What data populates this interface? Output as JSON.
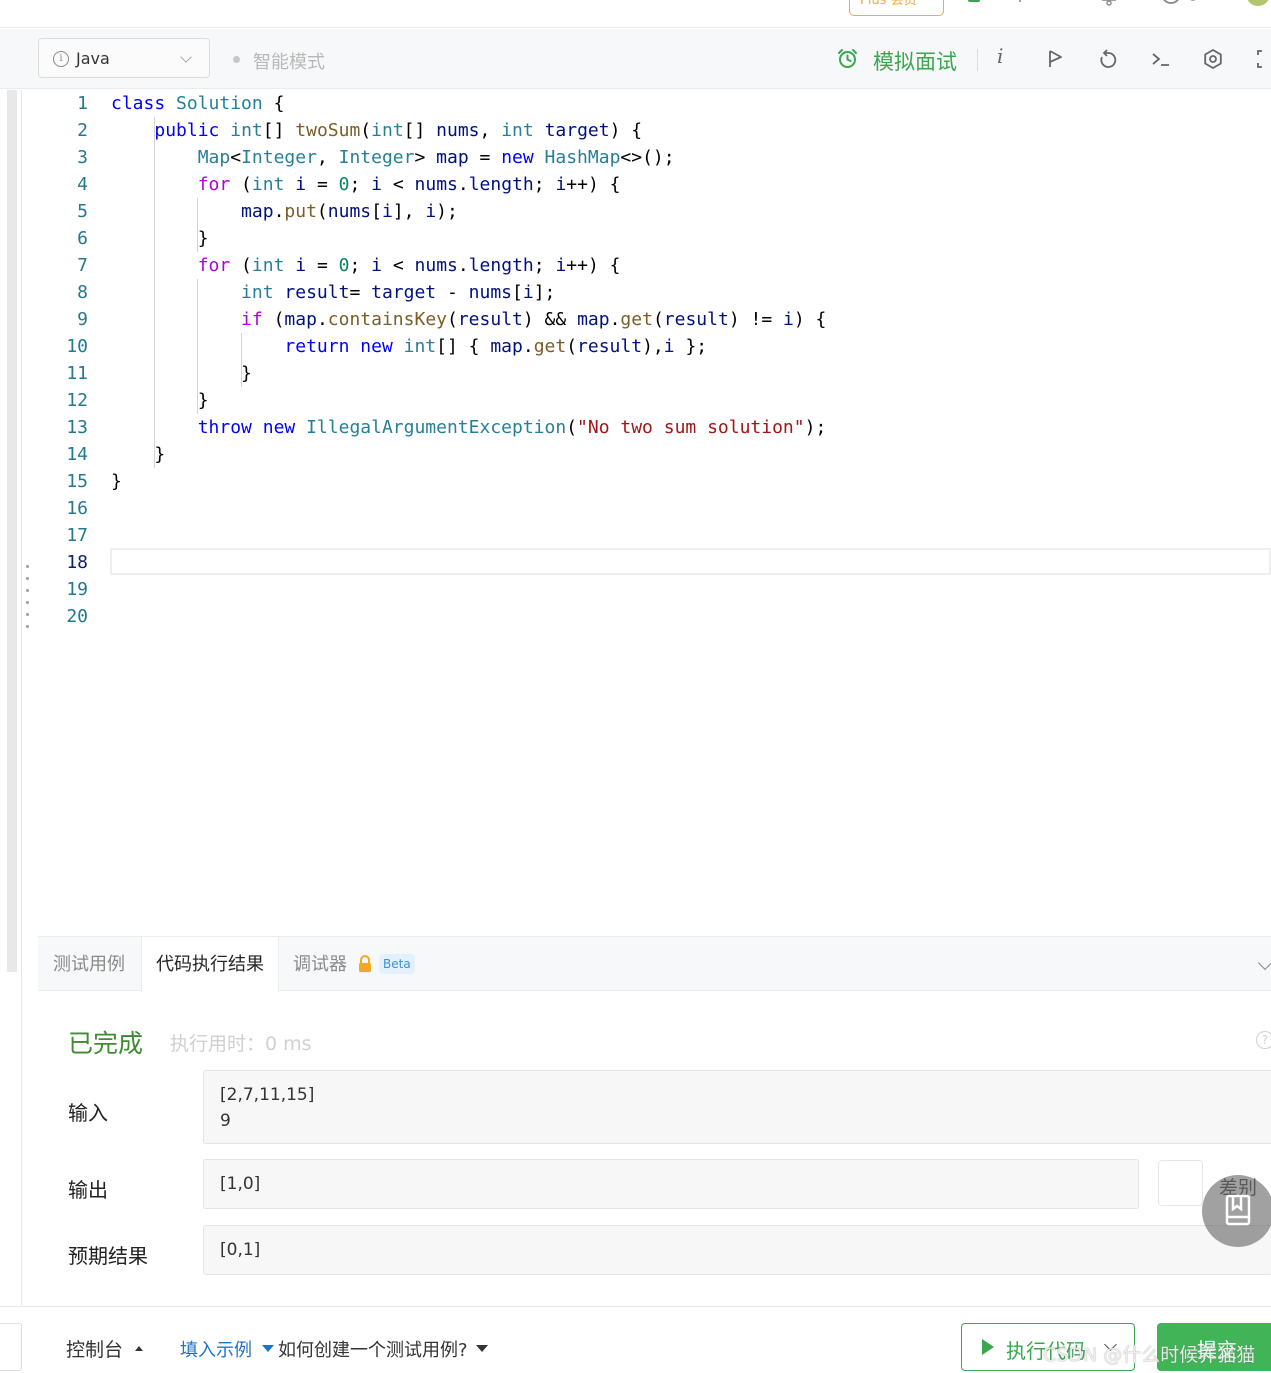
{
  "top_strip": {
    "plus_badge": "Plus 会员"
  },
  "toolbar": {
    "language": "Java",
    "smart_mode": "智能模式",
    "mock_interview": "模拟面试",
    "info_icon_text": "i"
  },
  "editor": {
    "active_line": "18",
    "lines": [
      {
        "n": "1"
      },
      {
        "n": "2"
      },
      {
        "n": "3"
      },
      {
        "n": "4"
      },
      {
        "n": "5"
      },
      {
        "n": "6"
      },
      {
        "n": "7"
      },
      {
        "n": "8"
      },
      {
        "n": "9"
      },
      {
        "n": "10"
      },
      {
        "n": "11"
      },
      {
        "n": "12"
      },
      {
        "n": "13"
      },
      {
        "n": "14"
      },
      {
        "n": "15"
      },
      {
        "n": "16"
      },
      {
        "n": "17"
      },
      {
        "n": "18"
      },
      {
        "n": "19"
      },
      {
        "n": "20"
      }
    ],
    "code": [
      "class Solution {",
      "    public int[] twoSum(int[] nums, int target) {",
      "        Map<Integer, Integer> map = new HashMap<>();",
      "        for (int i = 0; i < nums.length; i++) {",
      "            map.put(nums[i], i);",
      "        }",
      "        for (int i = 0; i < nums.length; i++) {",
      "            int result= target - nums[i];",
      "            if (map.containsKey(result) && map.get(result) != i) {",
      "                return new int[] { map.get(result),i };",
      "            }",
      "        }",
      "        throw new IllegalArgumentException(\"No two sum solution\");",
      "    }",
      "}",
      "",
      "",
      "",
      "",
      ""
    ]
  },
  "panel": {
    "tabs": [
      {
        "label": "测试用例"
      },
      {
        "label": "代码执行结果"
      },
      {
        "label": "调试器"
      }
    ],
    "beta": "Beta",
    "status": "已完成",
    "exec_time": "执行用时：0 ms",
    "help": "?",
    "input_label": "输入",
    "input_lines": [
      "[2,7,11,15]",
      "9"
    ],
    "output_label": "输出",
    "output_value": "[1,0]",
    "diff_label": "差别",
    "expected_label": "预期结果",
    "expected_value": "[0,1]"
  },
  "footer": {
    "console": "控制台",
    "fill_example": "填入示例",
    "howto": "如何创建一个测试用例?",
    "run": "执行代码",
    "submit": "提交"
  },
  "watermark": "CSDN @什么时候养猫猫",
  "colors": {
    "accent_green": "#3aa650",
    "submit_green": "#41b457",
    "status_green": "#3f8b34",
    "link_blue": "#1f73c9",
    "keyword_blue": "#0000ff",
    "type_teal": "#267f99",
    "line_number": "#237893"
  }
}
